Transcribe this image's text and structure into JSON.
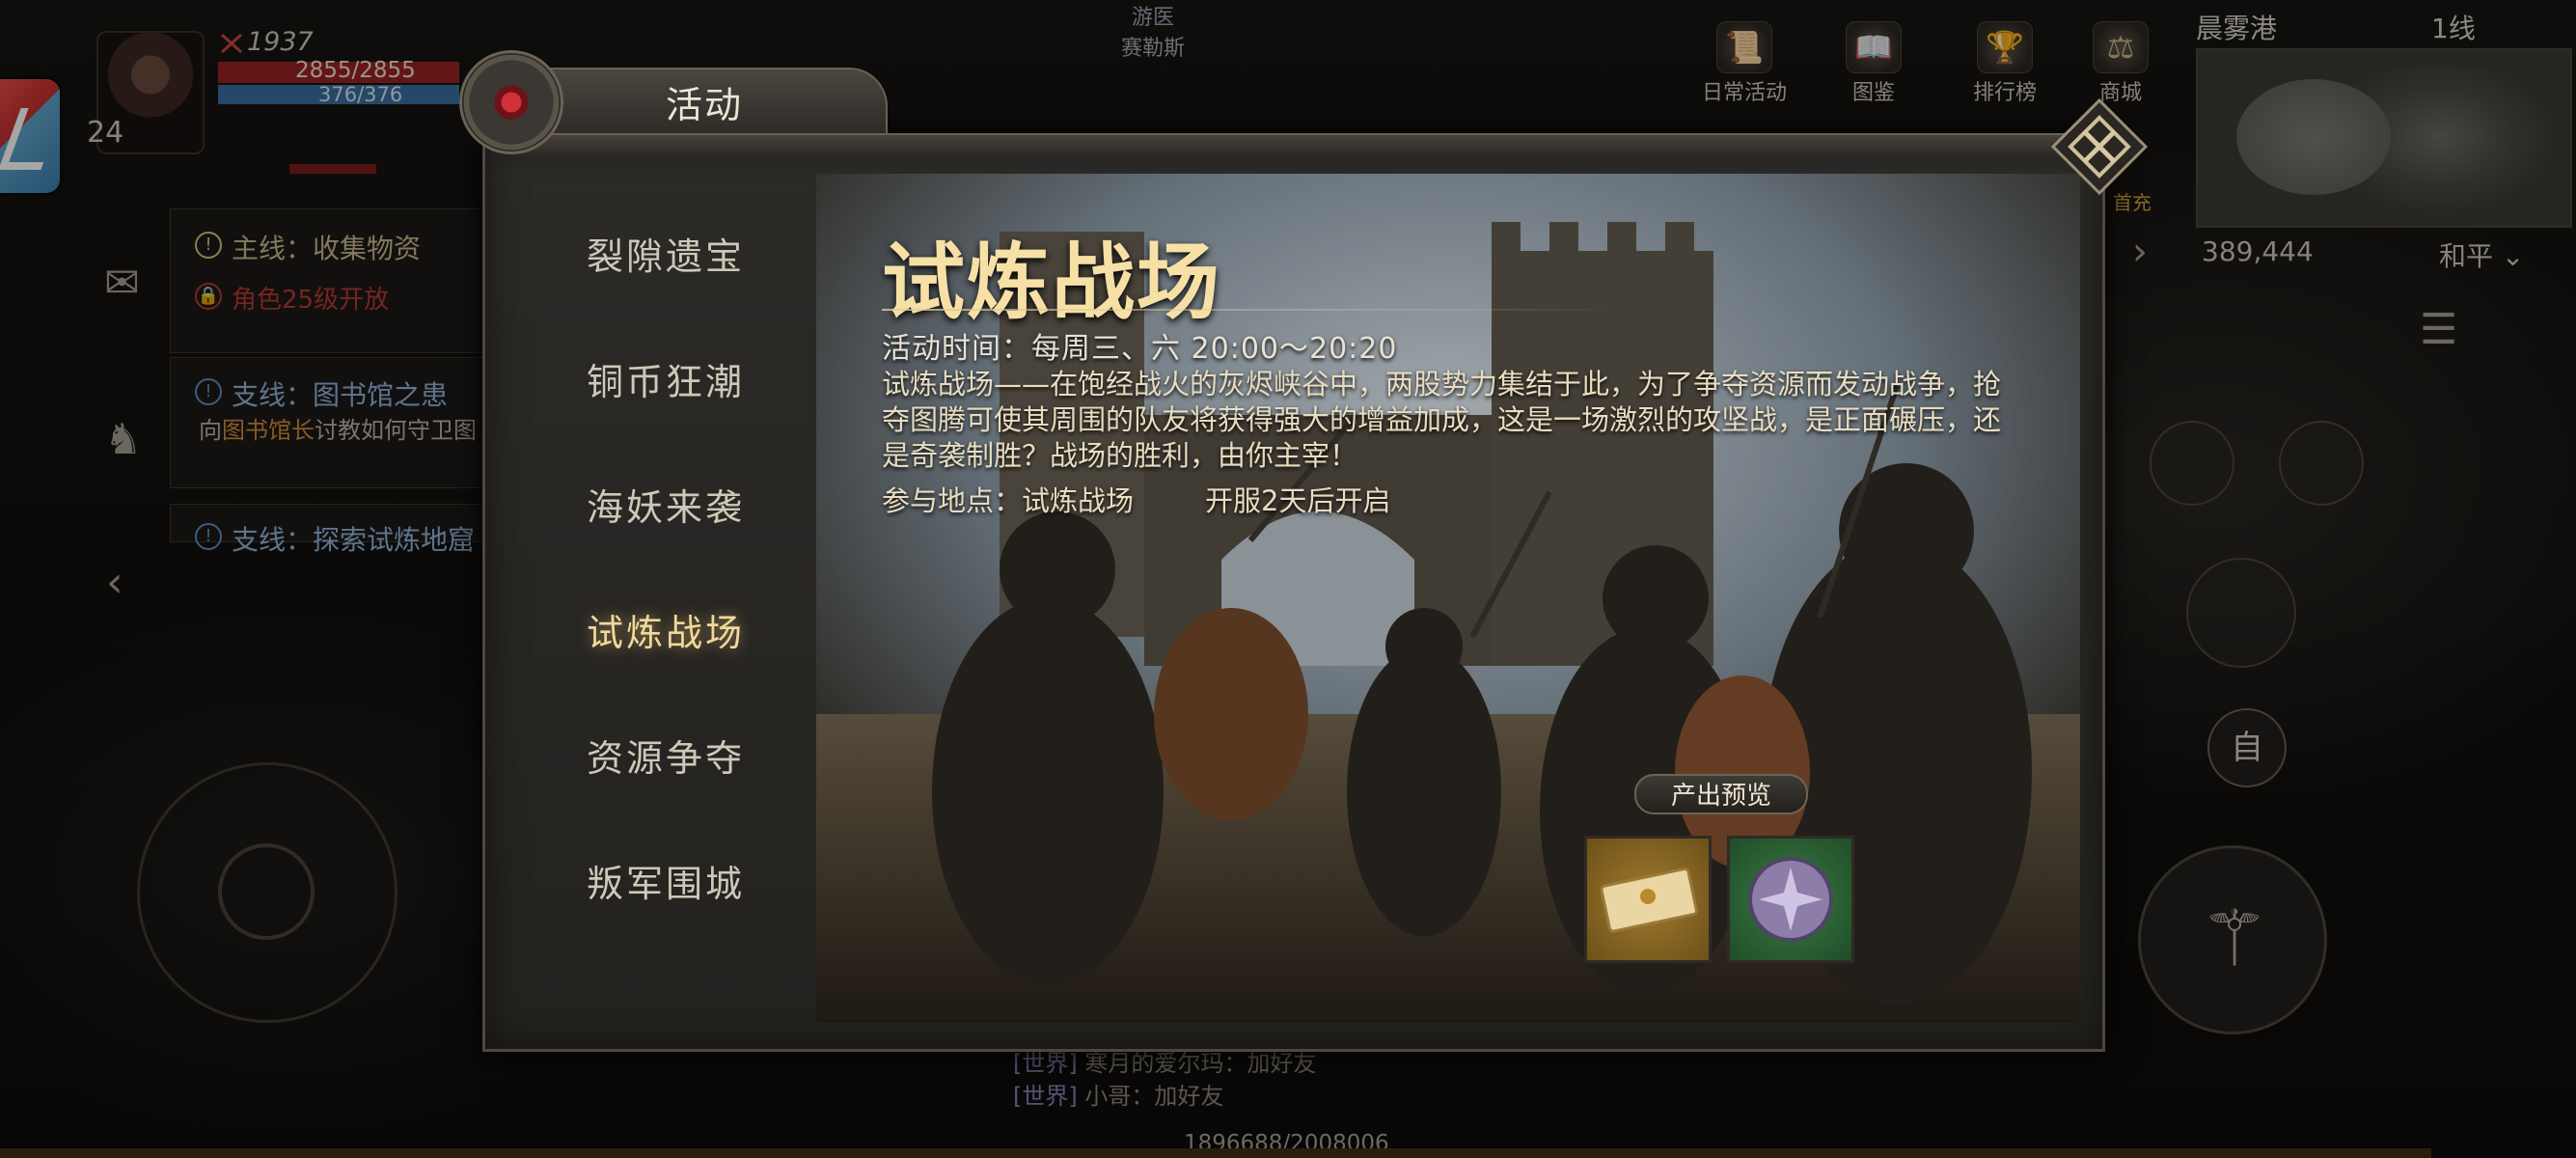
{
  "hud": {
    "player_level": "24",
    "power": "1937",
    "hp": "2855/2855",
    "mp": "376/376",
    "top_center": [
      "游医",
      "赛勒斯"
    ],
    "quests": [
      {
        "title": "主线：收集物资",
        "sub": "角色25级开放"
      },
      {
        "title": "支线：图书馆之患",
        "sub_prefix": "向",
        "sub_highlight": "图书馆长",
        "sub_suffix": "讨教如何守卫图"
      },
      {
        "title": "支线：探索试炼地窟"
      }
    ],
    "top_menu": [
      "日常活动",
      "图鉴",
      "排行榜",
      "商城"
    ],
    "recharge": "首充",
    "map_name": "晨雾港",
    "line": "1线",
    "coords": "389,444",
    "peace": "和平",
    "auto_label": "自",
    "chat": [
      {
        "channel": "[世界]",
        "text": "寒月的爱尔玛：加好友"
      },
      {
        "channel": "[世界]",
        "text": "小哥：加好友"
      }
    ],
    "xp": "1896688/2008006"
  },
  "modal": {
    "title": "活动",
    "tabs": [
      "裂隙遗宝",
      "铜币狂潮",
      "海妖来袭",
      "试炼战场",
      "资源争夺",
      "叛军围城"
    ],
    "active_tab": "试炼战场",
    "banner": {
      "title": "试炼战场",
      "time": "活动时间：每周三、六 20:00～20:20",
      "description": "试炼战场——在饱经战火的灰烬峡谷中，两股势力集结于此，为了争夺资源而发动战争，抢夺图腾可使其周围的队友将获得强大的增益加成，这是一场激烈的攻坚战，是正面碾压，还是奇袭制胜？战场的胜利，由你主宰！",
      "location": "参与地点：试炼战场",
      "open_condition": "开服2天后开启"
    },
    "preview_label": "产出预览",
    "rewards": [
      "ticket-icon",
      "medal-icon"
    ]
  },
  "colors": {
    "accent": "#f1d89b",
    "hp": "#9a2222",
    "mp": "#3a6fa0",
    "quest_red": "#b23a30"
  }
}
